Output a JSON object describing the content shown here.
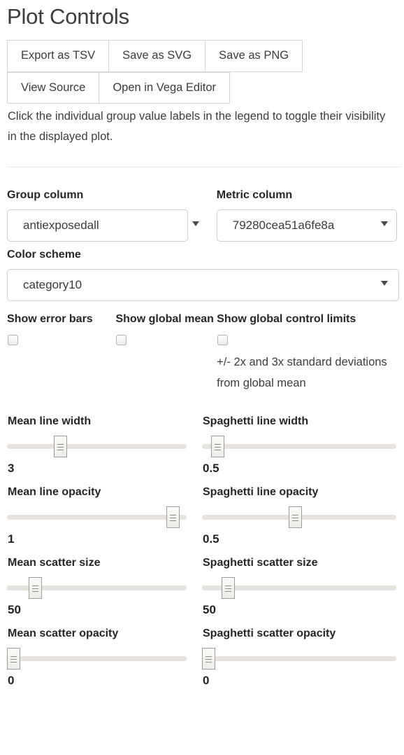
{
  "header": {
    "title": "Plot Controls"
  },
  "toolbar": {
    "buttons_row1": [
      {
        "label": "Export as TSV",
        "name": "export-tsv-button"
      },
      {
        "label": "Save as SVG",
        "name": "save-svg-button"
      },
      {
        "label": "Save as PNG",
        "name": "save-png-button"
      }
    ],
    "buttons_row2": [
      {
        "label": "View Source",
        "name": "view-source-button"
      },
      {
        "label": "Open in Vega Editor",
        "name": "open-vega-editor-button"
      }
    ]
  },
  "hint": "Click the individual group value labels in the legend to toggle their visibility in the displayed plot.",
  "selects": {
    "group_column": {
      "label": "Group column",
      "value": "antiexposedall"
    },
    "metric_column": {
      "label": "Metric column",
      "value": "79280cea51a6fe8a"
    },
    "color_scheme": {
      "label": "Color scheme",
      "value": "category10"
    }
  },
  "checkboxes": [
    {
      "label": "Show error bars",
      "checked": false,
      "note": ""
    },
    {
      "label": "Show global mean",
      "checked": false,
      "note": ""
    },
    {
      "label": "Show global control limits",
      "checked": false,
      "note": "+/- 2x and 3x standard deviations from global mean"
    }
  ],
  "sliders": [
    {
      "label": "Mean line width",
      "value": "3",
      "percent": 28
    },
    {
      "label": "Spaghetti line width",
      "value": "0.5",
      "percent": 5
    },
    {
      "label": "Mean line opacity",
      "value": "1",
      "percent": 96
    },
    {
      "label": "Spaghetti line opacity",
      "value": "0.5",
      "percent": 48
    },
    {
      "label": "Mean scatter size",
      "value": "50",
      "percent": 13
    },
    {
      "label": "Spaghetti scatter size",
      "value": "50",
      "percent": 11
    },
    {
      "label": "Mean scatter opacity",
      "value": "0",
      "percent": 0
    },
    {
      "label": "Spaghetti scatter opacity",
      "value": "0",
      "percent": 0
    }
  ],
  "colors": {
    "text": "#333333",
    "border": "#d6d6d6",
    "track": "#e6e3de",
    "thumb_border": "#9c9c9c"
  }
}
